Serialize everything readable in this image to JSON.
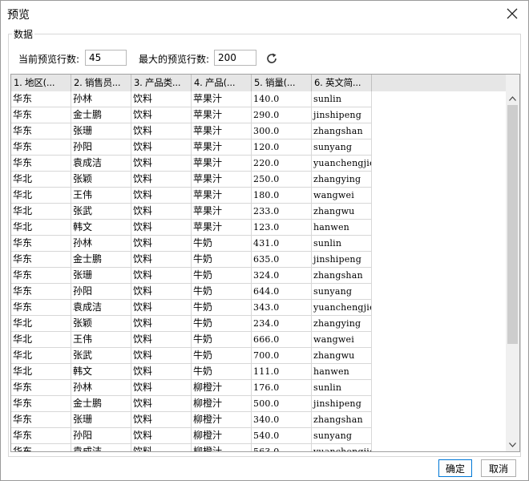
{
  "window": {
    "title": "预览"
  },
  "group": {
    "legend": "数据"
  },
  "options": {
    "current_rows_label": "当前预览行数:",
    "current_rows_value": "45",
    "max_rows_label": "最大的预览行数:",
    "max_rows_value": "200"
  },
  "table": {
    "columns": [
      "1. 地区(...",
      "2. 销售员...",
      "3. 产品类...",
      "4. 产品(...",
      "5. 销量(...",
      "6. 英文简..."
    ],
    "rows": [
      [
        "华东",
        "孙林",
        "饮料",
        "苹果汁",
        "140.0",
        "sunlin"
      ],
      [
        "华东",
        "金士鹏",
        "饮料",
        "苹果汁",
        "290.0",
        "jinshipeng"
      ],
      [
        "华东",
        "张珊",
        "饮料",
        "苹果汁",
        "300.0",
        "zhangshan"
      ],
      [
        "华东",
        "孙阳",
        "饮料",
        "苹果汁",
        "120.0",
        "sunyang"
      ],
      [
        "华东",
        "袁成洁",
        "饮料",
        "苹果汁",
        "220.0",
        "yuanchengjie"
      ],
      [
        "华北",
        "张颖",
        "饮料",
        "苹果汁",
        "250.0",
        "zhangying"
      ],
      [
        "华北",
        "王伟",
        "饮料",
        "苹果汁",
        "180.0",
        "wangwei"
      ],
      [
        "华北",
        "张武",
        "饮料",
        "苹果汁",
        "233.0",
        "zhangwu"
      ],
      [
        "华北",
        "韩文",
        "饮料",
        "苹果汁",
        "123.0",
        "hanwen"
      ],
      [
        "华东",
        "孙林",
        "饮料",
        "牛奶",
        "431.0",
        "sunlin"
      ],
      [
        "华东",
        "金士鹏",
        "饮料",
        "牛奶",
        "635.0",
        "jinshipeng"
      ],
      [
        "华东",
        "张珊",
        "饮料",
        "牛奶",
        "324.0",
        "zhangshan"
      ],
      [
        "华东",
        "孙阳",
        "饮料",
        "牛奶",
        "644.0",
        "sunyang"
      ],
      [
        "华东",
        "袁成洁",
        "饮料",
        "牛奶",
        "343.0",
        "yuanchengjie"
      ],
      [
        "华北",
        "张颖",
        "饮料",
        "牛奶",
        "234.0",
        "zhangying"
      ],
      [
        "华北",
        "王伟",
        "饮料",
        "牛奶",
        "666.0",
        "wangwei"
      ],
      [
        "华北",
        "张武",
        "饮料",
        "牛奶",
        "700.0",
        "zhangwu"
      ],
      [
        "华北",
        "韩文",
        "饮料",
        "牛奶",
        "111.0",
        "hanwen"
      ],
      [
        "华东",
        "孙林",
        "饮料",
        "柳橙汁",
        "176.0",
        "sunlin"
      ],
      [
        "华东",
        "金士鹏",
        "饮料",
        "柳橙汁",
        "500.0",
        "jinshipeng"
      ],
      [
        "华东",
        "张珊",
        "饮料",
        "柳橙汁",
        "340.0",
        "zhangshan"
      ],
      [
        "华东",
        "孙阳",
        "饮料",
        "柳橙汁",
        "540.0",
        "sunyang"
      ],
      [
        "华东",
        "袁成洁",
        "饮料",
        "柳橙汁",
        "563.0",
        "yuanchengjie"
      ]
    ]
  },
  "buttons": {
    "ok": "确定",
    "cancel": "取消"
  },
  "icons": {
    "close": "close-icon",
    "refresh": "refresh-icon",
    "scroll_up": "chevron-up-icon",
    "scroll_down": "chevron-down-icon"
  }
}
